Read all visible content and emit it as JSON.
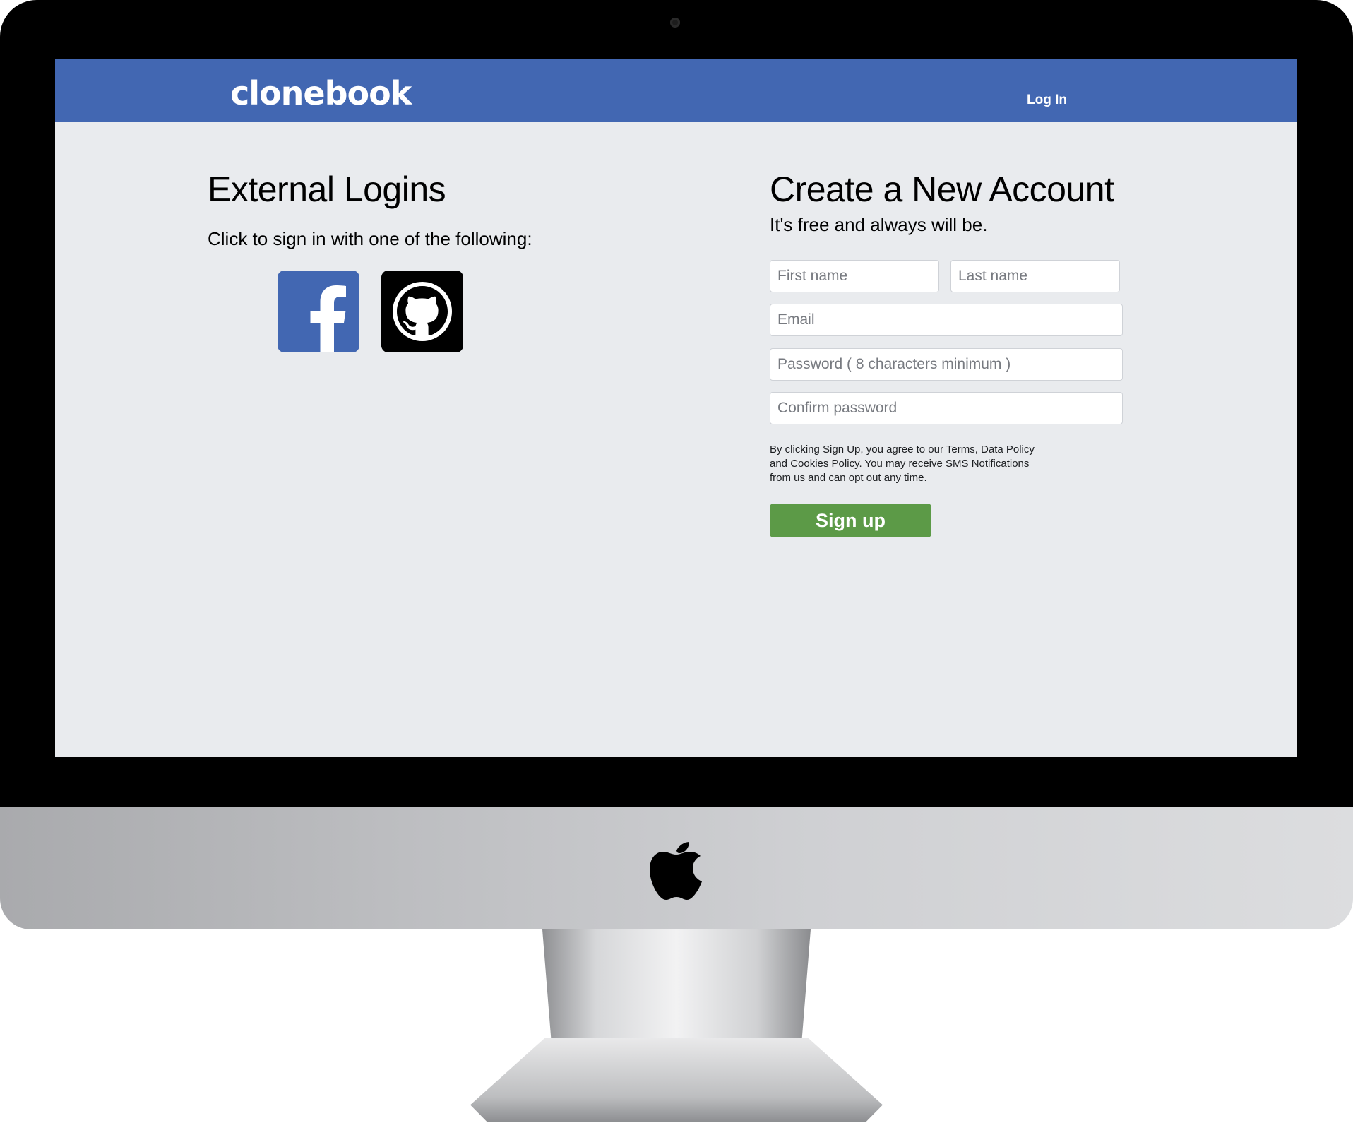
{
  "header": {
    "brand": "clonebook",
    "login_label": "Log In",
    "color": "#4267b2"
  },
  "external": {
    "title": "External Logins",
    "subtitle": "Click to sign in with one of the following:",
    "providers": [
      {
        "name": "facebook",
        "icon": "facebook-icon",
        "color": "#4267b2"
      },
      {
        "name": "github",
        "icon": "github-icon",
        "color": "#000000"
      }
    ]
  },
  "signup": {
    "title": "Create a New Account",
    "subtitle": "It's free and always will be.",
    "fields": {
      "first_name": {
        "placeholder": "First name",
        "value": ""
      },
      "last_name": {
        "placeholder": "Last name",
        "value": ""
      },
      "email": {
        "placeholder": "Email",
        "value": ""
      },
      "password": {
        "placeholder": "Password ( 8 characters minimum )",
        "value": ""
      },
      "confirm_password": {
        "placeholder": "Confirm password",
        "value": ""
      }
    },
    "terms": "By clicking Sign Up, you agree to our Terms, Data Policy and Cookies Policy. You may receive SMS Notifications from us and can opt out any time.",
    "button_label": "Sign up",
    "button_color": "#5c9a47"
  },
  "device": {
    "logo_icon": "apple-icon",
    "camera_icon": "camera-icon"
  }
}
